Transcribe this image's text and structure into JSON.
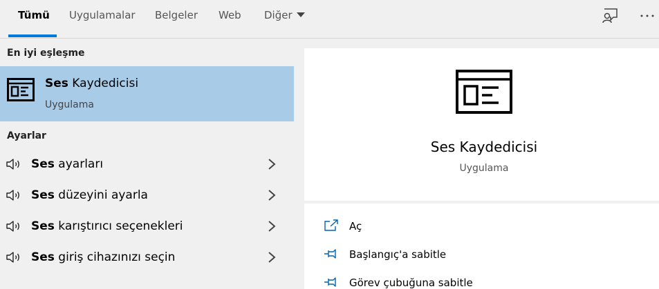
{
  "tabs": [
    {
      "label": "Tümü",
      "active": true
    },
    {
      "label": "Uygulamalar"
    },
    {
      "label": "Belgeler"
    },
    {
      "label": "Web"
    },
    {
      "label": "Diğer"
    }
  ],
  "topbar": {
    "feedback_icon": "feedback-person-icon",
    "more_icon": "more-ellipsis-icon"
  },
  "best_match": {
    "section_label": "En iyi eşleşme",
    "title_bold": "Ses",
    "title_rest": " Kaydedicisi",
    "subtitle": "Uygulama",
    "icon": "app-window-icon"
  },
  "settings": {
    "section_label": "Ayarlar",
    "items": [
      {
        "bold": "Ses",
        "rest": " ayarları"
      },
      {
        "bold": "Ses",
        "rest": " düzeyini ayarla"
      },
      {
        "bold": "Ses",
        "rest": " karıştırıcı seçenekleri"
      },
      {
        "bold": "Ses",
        "rest": " giriş cihazınızı seçin"
      }
    ]
  },
  "detail": {
    "title": "Ses Kaydedicisi",
    "subtitle": "Uygulama",
    "actions": [
      {
        "label": "Aç",
        "icon": "open-icon"
      },
      {
        "label": "Başlangıç'a sabitle",
        "icon": "pin-icon"
      },
      {
        "label": "Görev çubuğuna sabitle",
        "icon": "pin-icon"
      }
    ]
  },
  "colors": {
    "accent": "#0078d7",
    "selection": "#a8cbe8",
    "action_icon": "#0063b1"
  }
}
